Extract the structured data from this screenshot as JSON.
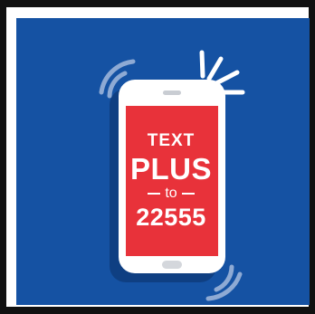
{
  "graphic": {
    "line1": "TEXT",
    "line2": "PLUS",
    "line3": "to",
    "line4": "22555",
    "colors": {
      "background": "#1552a3",
      "phone_body": "#ffffff",
      "screen": "#e8323a",
      "shadow": "#0f3f82",
      "vibration_marks": "#ffffff"
    },
    "icons": [
      "smartphone-icon",
      "vibration-icon",
      "notification-burst-icon"
    ]
  }
}
